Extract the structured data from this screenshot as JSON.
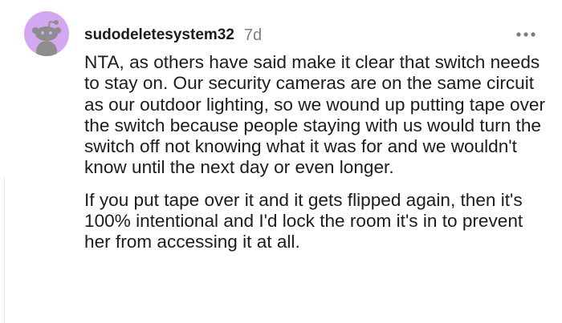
{
  "comment": {
    "author": "sudodeletesystem32",
    "age": "7d",
    "avatar_icon": "snoo-avatar-icon",
    "more_icon": "more-options-icon",
    "paragraphs": [
      "NTA, as others have said make it clear that switch needs to stay on. Our security cameras are on the same circuit as our outdoor lighting, so we wound up putting tape over the switch because people staying with us would turn the switch off not knowing what it was for and we wouldn't know until the next day or even longer.",
      "If you put tape over it and it gets flipped again, then it's 100% intentional and I'd lock the room it's in to prevent her from accessing it at all."
    ]
  },
  "colors": {
    "avatar_bg": "#d4a8f0",
    "avatar_figure": "#8d8d8d",
    "text": "#1c1c1c",
    "muted": "#7c7c7c"
  }
}
